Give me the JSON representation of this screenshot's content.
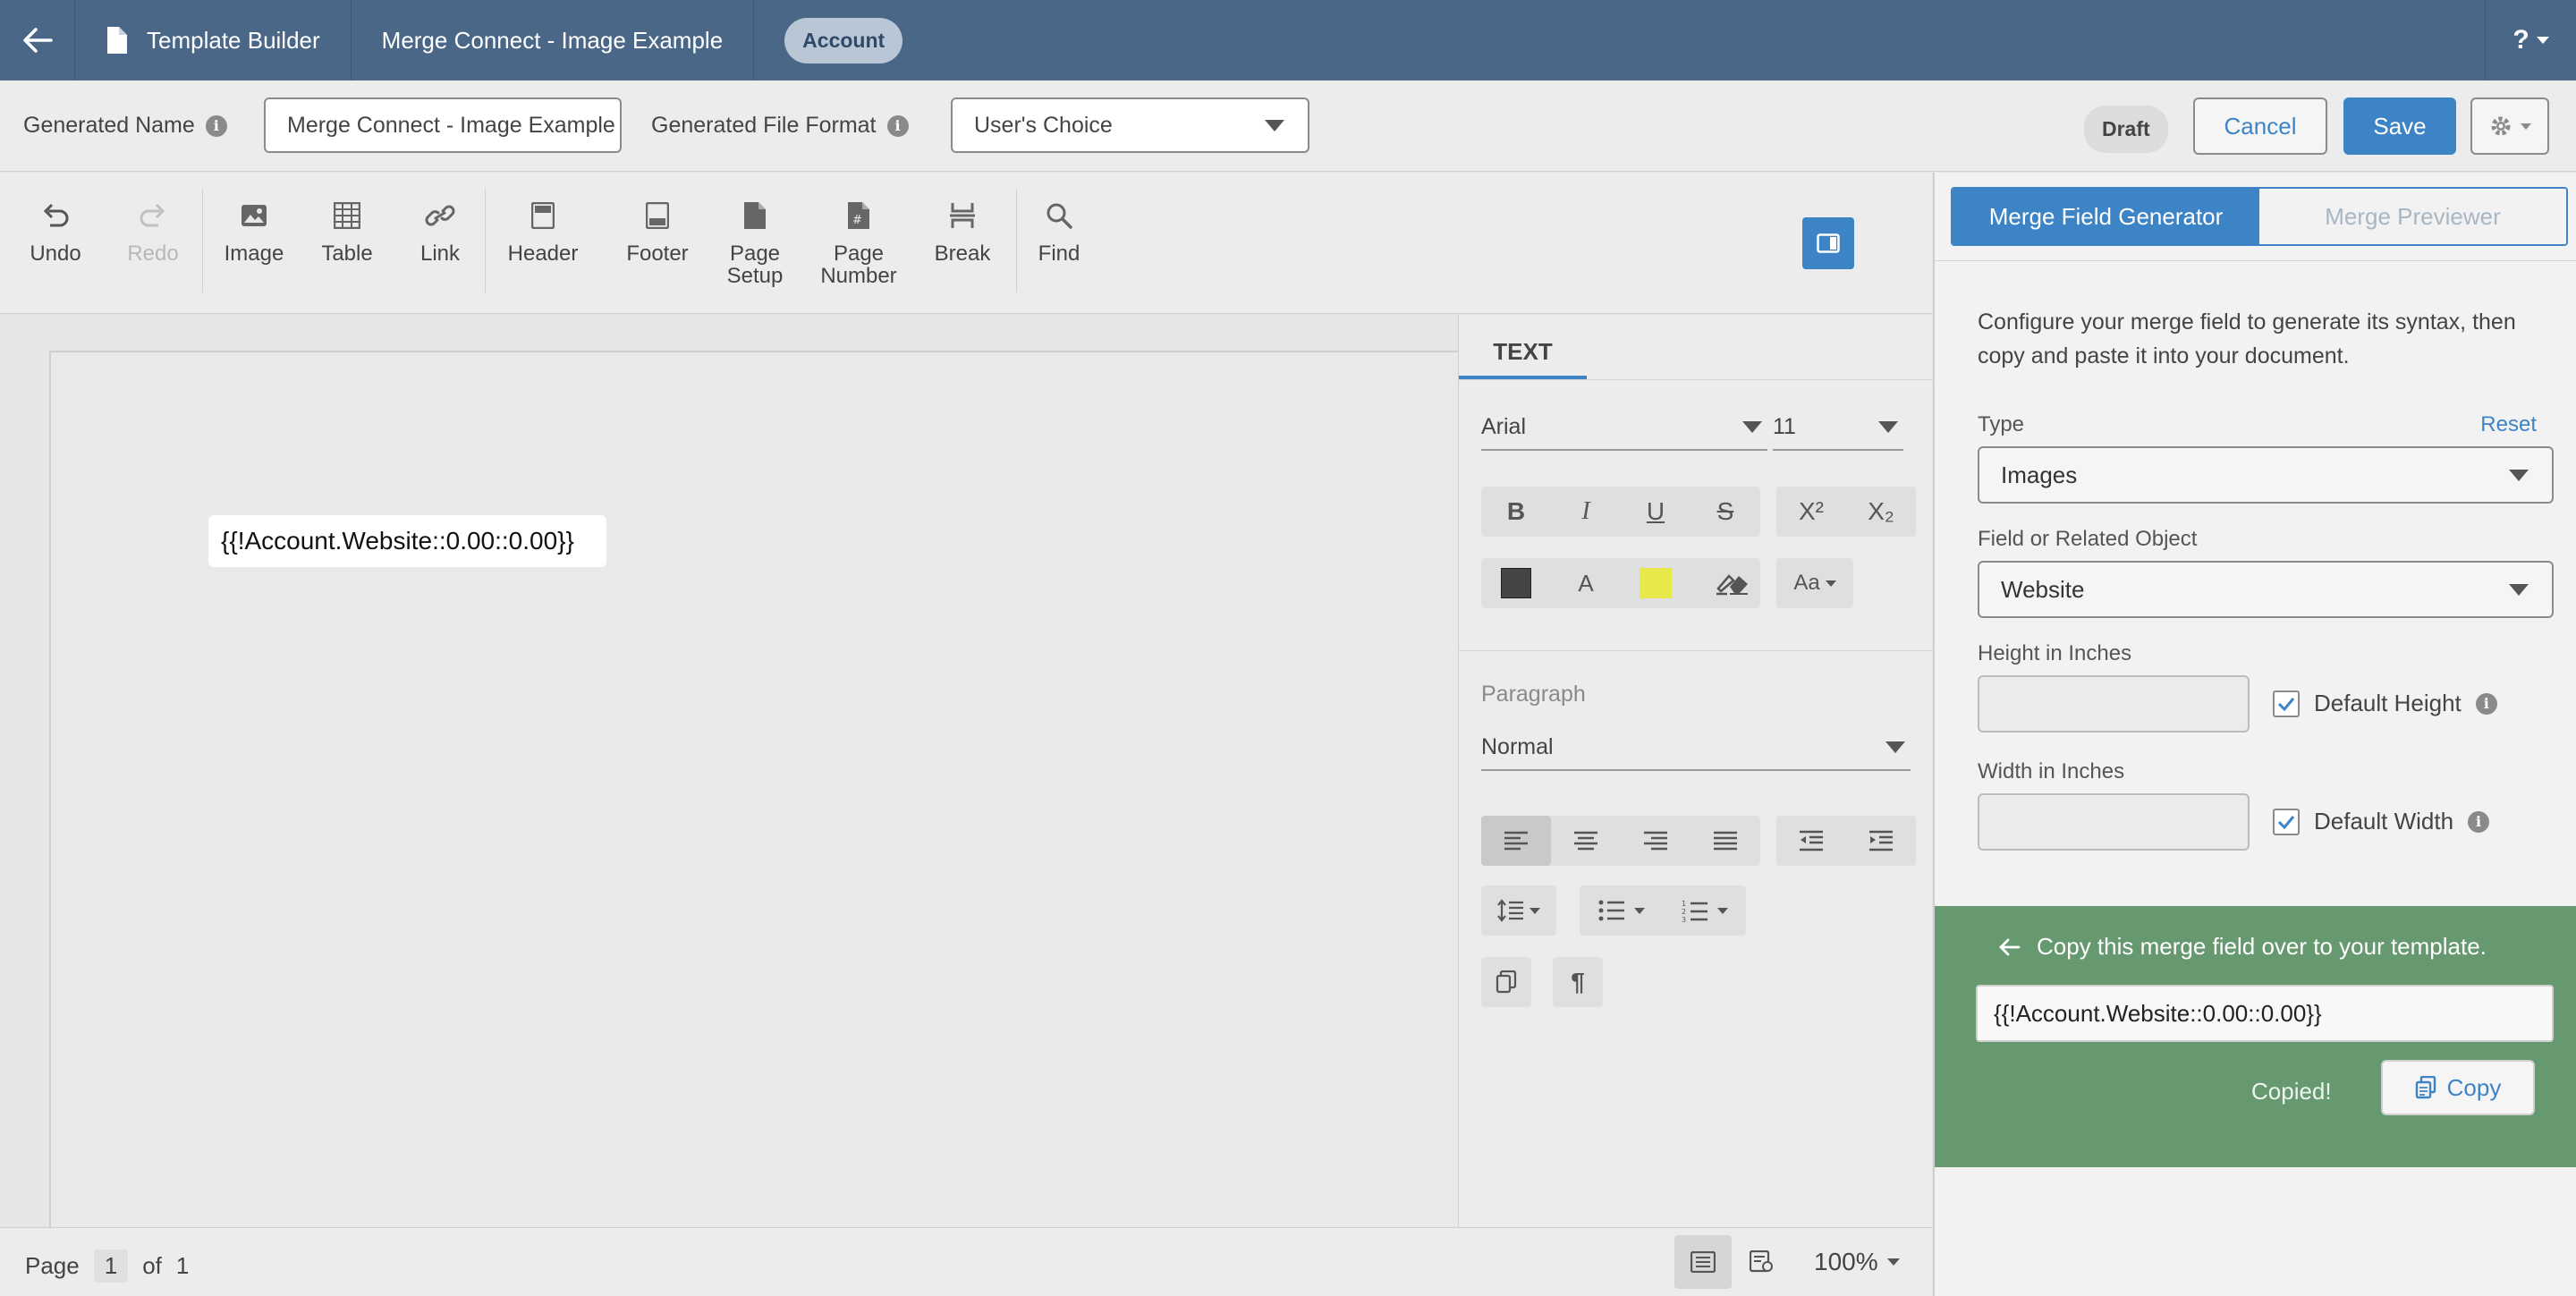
{
  "topbar": {
    "app_label": "Template Builder",
    "template_name": "Merge Connect - Image Example",
    "object_badge": "Account",
    "help": "?"
  },
  "settings": {
    "generated_name_label": "Generated Name",
    "generated_name_value": "Merge Connect - Image Example",
    "file_format_label": "Generated File Format",
    "file_format_value": "User's Choice",
    "status": "Draft",
    "cancel": "Cancel",
    "save": "Save"
  },
  "toolbar": {
    "undo": "Undo",
    "redo": "Redo",
    "image": "Image",
    "table": "Table",
    "link": "Link",
    "header": "Header",
    "footer": "Footer",
    "page_setup_1": "Page",
    "page_setup_2": "Setup",
    "page_number_1": "Page",
    "page_number_2": "Number",
    "break": "Break",
    "find": "Find"
  },
  "document": {
    "merge_field_text": "{{!Account.Website::0.00::0.00}}"
  },
  "format_panel": {
    "tab": "TEXT",
    "font": "Arial",
    "size": "11",
    "superscript": "X²",
    "subscript": "X₂",
    "case": "Aa",
    "paragraph_label": "Paragraph",
    "paragraph_style": "Normal",
    "text_color": "#444444",
    "highlight_color": "#e8e84a"
  },
  "right_panel": {
    "tab_generator": "Merge Field Generator",
    "tab_previewer": "Merge Previewer",
    "description": "Configure your merge field to generate its syntax, then copy and paste it into your document.",
    "type_label": "Type",
    "reset": "Reset",
    "type_value": "Images",
    "field_label": "Field or Related Object",
    "field_value": "Website",
    "height_label": "Height in Inches",
    "default_height": "Default Height",
    "width_label": "Width in Inches",
    "default_width": "Default Width",
    "copy_message": "Copy this merge field over to your template.",
    "merge_field": "{{!Account.Website::0.00::0.00}}",
    "copied": "Copied!",
    "copy_button": "Copy"
  },
  "statusbar": {
    "page_label": "Page",
    "page_current": "1",
    "of_label": "of",
    "page_total": "1",
    "zoom": "100%"
  },
  "colors": {
    "header_bg": "#4a6788",
    "accent": "#3d84c6",
    "copy_panel_bg": "#66996f"
  }
}
